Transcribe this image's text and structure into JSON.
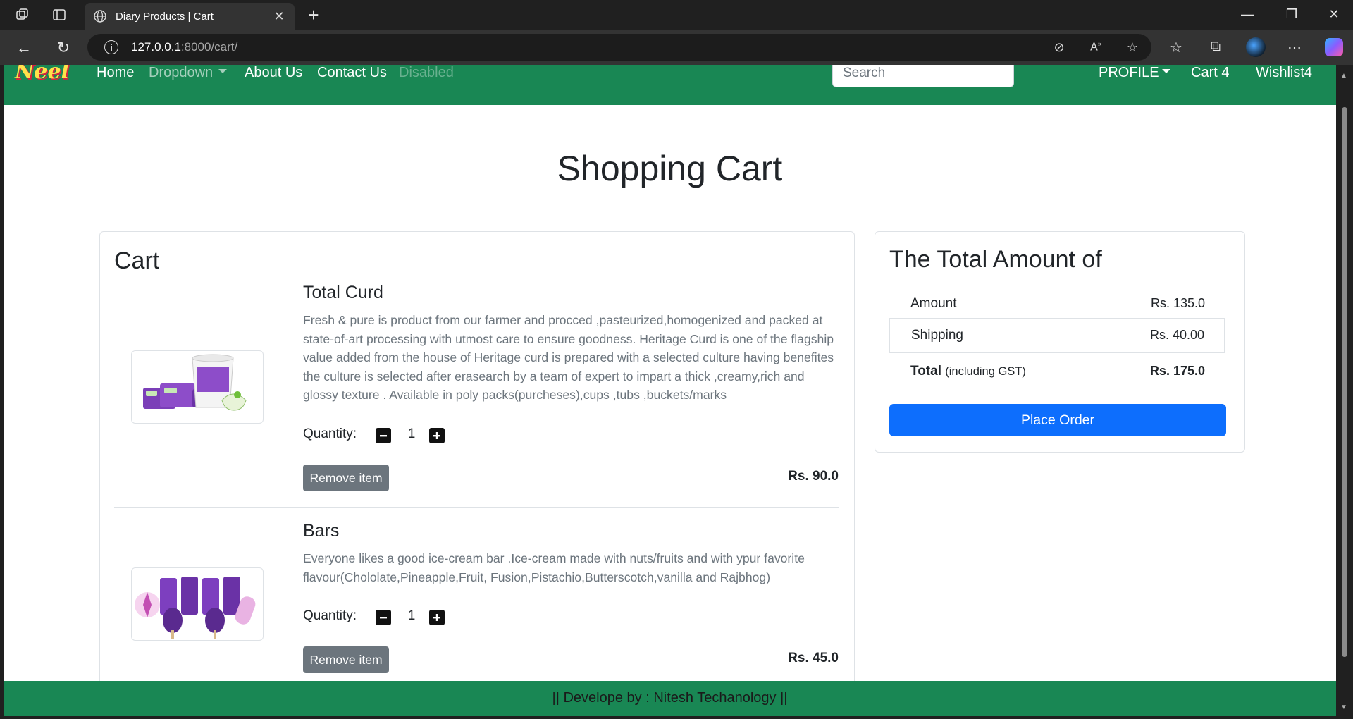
{
  "browser": {
    "tab_title": "Diary Products | Cart",
    "url_host": "127.0.0.1",
    "url_path": ":8000/cart/"
  },
  "navbar": {
    "brand": "Neel",
    "links": {
      "home": "Home",
      "dropdown": "Dropdown",
      "about": "About Us",
      "contact": "Contact Us",
      "disabled": "Disabled"
    },
    "search_placeholder": "Search",
    "profile": "PROFILE",
    "cart": "Cart 4",
    "wishlist": "Wishlist4",
    "color": "#198754"
  },
  "page_title": "Shopping Cart",
  "cart": {
    "heading": "Cart",
    "quantity_label": "Quantity:",
    "remove_label": "Remove item",
    "items": [
      {
        "name": "Total Curd",
        "description": "Fresh & pure is product from our farmer and procced ,pasteurized,homogenized and packed at state-of-art processing with utmost care to ensure goodness. Heritage Curd is one of the flagship value added from the house of Heritage curd is prepared with a selected culture having benefites the culture is selected after erasearch by a team of expert to impart a thick ,creamy,rich and glossy texture . Available in poly packs(purcheses),cups ,tubs ,buckets/marks",
        "quantity": "1",
        "price": "Rs. 90.0"
      },
      {
        "name": "Bars",
        "description": "Everyone likes a good ice-cream bar .Ice-cream made with nuts/fruits and with ypur favorite flavour(Chololate,Pineapple,Fruit, Fusion,Pistachio,Butterscotch,vanilla and Rajbhog)",
        "quantity": "1",
        "price": "Rs. 45.0"
      }
    ]
  },
  "summary": {
    "heading": "The Total Amount of",
    "amount_label": "Amount",
    "amount_value": "Rs. 135.0",
    "shipping_label": "Shipping",
    "shipping_value": "Rs. 40.00",
    "total_label": "Total",
    "total_sub": "(including GST)",
    "total_value": "Rs. 175.0",
    "place_order": "Place Order",
    "button_color": "#0d6efd"
  },
  "footer": "|| Develope by : Nitesh Techanology ||"
}
